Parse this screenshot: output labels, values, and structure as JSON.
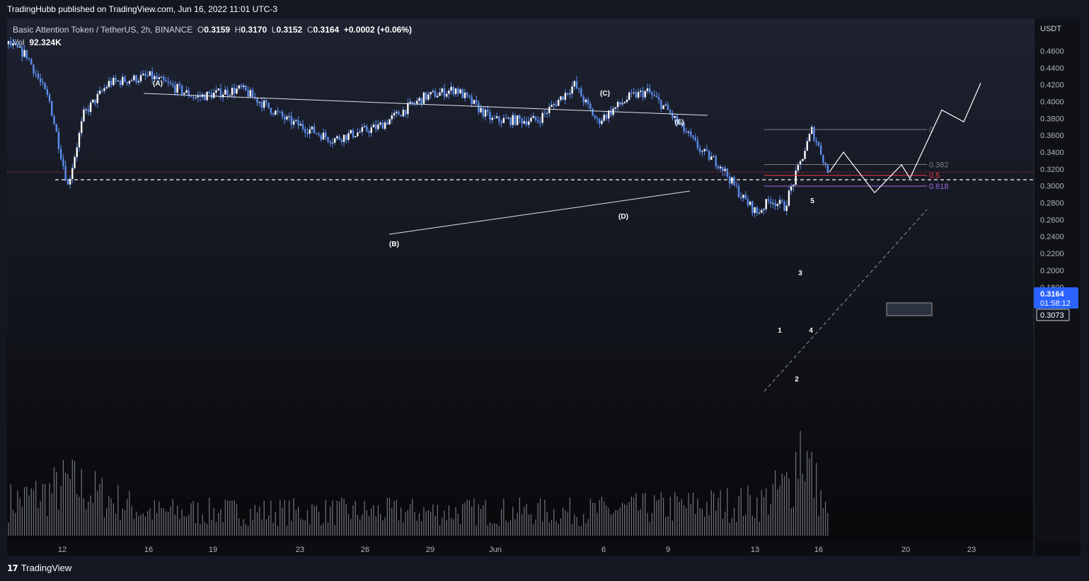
{
  "header": {
    "publisher_line": "TradingHubb published on TradingView.com, Jun 16, 2022 11:01 UTC-3"
  },
  "legend": {
    "symbol": "Basic Attention Token / TetherUS, 2h, BINANCE",
    "o_label": "O",
    "o_value": "0.3159",
    "h_label": "H",
    "h_value": "0.3170",
    "l_label": "L",
    "l_value": "0.3152",
    "c_label": "C",
    "c_value": "0.3164",
    "change": "+0.0002 (+0.06%)",
    "vol_label": "Vol",
    "vol_value": "92.324K"
  },
  "footer": {
    "brand": "TradingView"
  },
  "colors": {
    "background": "#131722",
    "candle": "#ffffff",
    "wick": "#5b8def",
    "volume": "#9598a1",
    "price_tag": "#2962ff",
    "fib_05": "#f23645",
    "fib_0618": "#9c6ade",
    "fib_neutral": "#787b86"
  },
  "chart_data": {
    "type": "candlestick",
    "currency": "USDT",
    "ylim": [
      0.17,
      0.48
    ],
    "y_ticks": [
      "0.4600",
      "0.4400",
      "0.4200",
      "0.4000",
      "0.3800",
      "0.3600",
      "0.3400",
      "0.3200",
      "0.3000",
      "0.2800",
      "0.2600",
      "0.2400",
      "0.2200",
      "0.2000",
      "0.1800"
    ],
    "x_ticks": [
      "12",
      "16",
      "19",
      "23",
      "26",
      "29",
      "Jun",
      "6",
      "9",
      "13",
      "16",
      "20",
      "23"
    ],
    "current_price": "0.3164",
    "countdown": "01:58:12",
    "support_level": "0.3073",
    "price_path": [
      {
        "t": 0,
        "p": 0.468
      },
      {
        "t": 8,
        "p": 0.455
      },
      {
        "t": 18,
        "p": 0.4
      },
      {
        "t": 26,
        "p": 0.3
      },
      {
        "t": 33,
        "p": 0.385
      },
      {
        "t": 44,
        "p": 0.422
      },
      {
        "t": 62,
        "p": 0.43
      },
      {
        "t": 82,
        "p": 0.405
      },
      {
        "t": 102,
        "p": 0.415
      },
      {
        "t": 122,
        "p": 0.378
      },
      {
        "t": 142,
        "p": 0.355
      },
      {
        "t": 162,
        "p": 0.37
      },
      {
        "t": 182,
        "p": 0.405
      },
      {
        "t": 196,
        "p": 0.415
      },
      {
        "t": 212,
        "p": 0.378
      },
      {
        "t": 232,
        "p": 0.378
      },
      {
        "t": 248,
        "p": 0.42
      },
      {
        "t": 258,
        "p": 0.376
      },
      {
        "t": 272,
        "p": 0.405
      },
      {
        "t": 280,
        "p": 0.412
      },
      {
        "t": 288,
        "p": 0.392
      },
      {
        "t": 296,
        "p": 0.366
      },
      {
        "t": 304,
        "p": 0.34
      },
      {
        "t": 312,
        "p": 0.325
      },
      {
        "t": 318,
        "p": 0.3
      },
      {
        "t": 322,
        "p": 0.285
      },
      {
        "t": 328,
        "p": 0.268
      },
      {
        "t": 334,
        "p": 0.284
      },
      {
        "t": 340,
        "p": 0.275
      },
      {
        "t": 346,
        "p": 0.32
      },
      {
        "t": 352,
        "p": 0.366
      },
      {
        "t": 356,
        "p": 0.34
      },
      {
        "t": 359,
        "p": 0.3164
      }
    ],
    "volume_path": [
      {
        "t": 0,
        "v": 0.35
      },
      {
        "t": 18,
        "v": 0.45
      },
      {
        "t": 26,
        "v": 0.55
      },
      {
        "t": 60,
        "v": 0.25
      },
      {
        "t": 150,
        "v": 0.25
      },
      {
        "t": 250,
        "v": 0.25
      },
      {
        "t": 330,
        "v": 0.35
      },
      {
        "t": 343,
        "v": 0.55
      },
      {
        "t": 347,
        "v": 1.0
      },
      {
        "t": 351,
        "v": 0.7
      },
      {
        "t": 359,
        "v": 0.2
      }
    ],
    "wave_labels": [
      "(A)",
      "(B)",
      "(C)",
      "(D)",
      "(E)",
      "1",
      "2",
      "3",
      "4",
      "5"
    ],
    "fib_levels": [
      {
        "label": "0",
        "price": 0.3668
      },
      {
        "label": "0.382",
        "price": 0.3254
      },
      {
        "label": "0.5",
        "price": 0.3126
      },
      {
        "label": "0.618",
        "price": 0.2998
      }
    ],
    "projection_prices": [
      0.3164,
      0.34,
      0.292,
      0.325,
      0.309,
      0.39,
      0.376,
      0.422
    ]
  }
}
